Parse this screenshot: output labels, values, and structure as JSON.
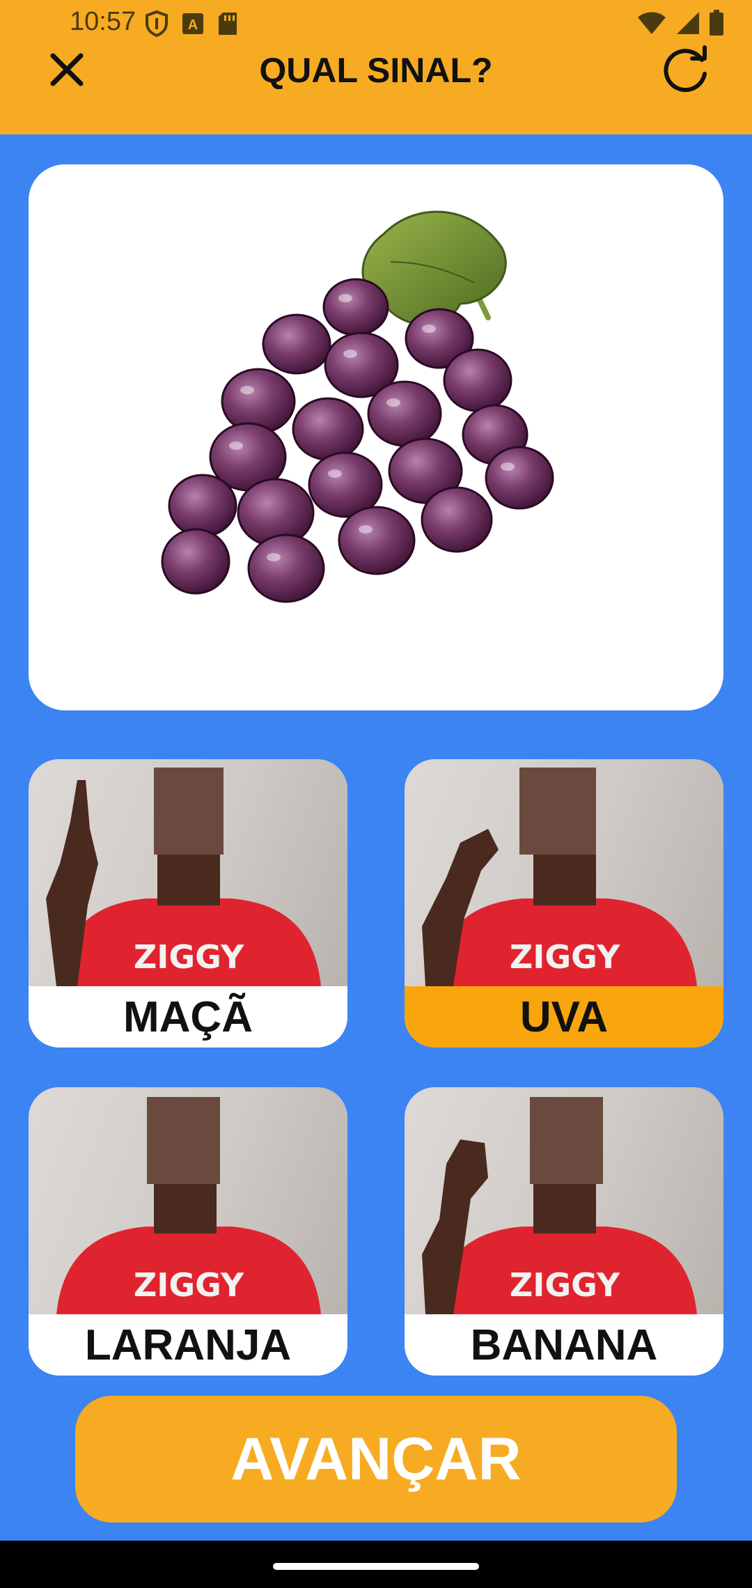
{
  "status_bar": {
    "time": "10:57",
    "icons": [
      "shield-icon",
      "font-download-icon",
      "sd-card-icon",
      "wifi-icon",
      "signal-icon",
      "battery-icon"
    ]
  },
  "header": {
    "title": "QUAL SINAL?",
    "close_icon": "close-icon",
    "refresh_icon": "refresh-icon",
    "background": "#f7ab22"
  },
  "prompt_image": {
    "subject": "grapes"
  },
  "options": [
    {
      "label": "MAÇÃ",
      "selected": false
    },
    {
      "label": "UVA",
      "selected": true
    },
    {
      "label": "LARANJA",
      "selected": false
    },
    {
      "label": "BANANA",
      "selected": false
    }
  ],
  "advance_button": {
    "label": "AVANÇAR"
  },
  "colors": {
    "page_background": "#3b84f2",
    "accent": "#f7ab22",
    "selected_label": "#f9a50d"
  }
}
